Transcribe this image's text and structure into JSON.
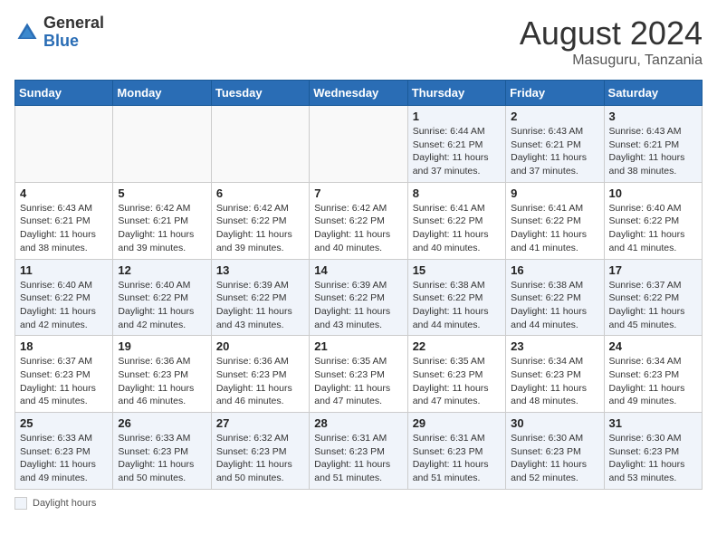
{
  "header": {
    "logo_general": "General",
    "logo_blue": "Blue",
    "title": "August 2024",
    "location": "Masuguru, Tanzania"
  },
  "weekdays": [
    "Sunday",
    "Monday",
    "Tuesday",
    "Wednesday",
    "Thursday",
    "Friday",
    "Saturday"
  ],
  "legend": {
    "label": "Daylight hours"
  },
  "weeks": [
    [
      {
        "day": "",
        "info": ""
      },
      {
        "day": "",
        "info": ""
      },
      {
        "day": "",
        "info": ""
      },
      {
        "day": "",
        "info": ""
      },
      {
        "day": "1",
        "info": "Sunrise: 6:44 AM\nSunset: 6:21 PM\nDaylight: 11 hours and 37 minutes."
      },
      {
        "day": "2",
        "info": "Sunrise: 6:43 AM\nSunset: 6:21 PM\nDaylight: 11 hours and 37 minutes."
      },
      {
        "day": "3",
        "info": "Sunrise: 6:43 AM\nSunset: 6:21 PM\nDaylight: 11 hours and 38 minutes."
      }
    ],
    [
      {
        "day": "4",
        "info": "Sunrise: 6:43 AM\nSunset: 6:21 PM\nDaylight: 11 hours and 38 minutes."
      },
      {
        "day": "5",
        "info": "Sunrise: 6:42 AM\nSunset: 6:21 PM\nDaylight: 11 hours and 39 minutes."
      },
      {
        "day": "6",
        "info": "Sunrise: 6:42 AM\nSunset: 6:22 PM\nDaylight: 11 hours and 39 minutes."
      },
      {
        "day": "7",
        "info": "Sunrise: 6:42 AM\nSunset: 6:22 PM\nDaylight: 11 hours and 40 minutes."
      },
      {
        "day": "8",
        "info": "Sunrise: 6:41 AM\nSunset: 6:22 PM\nDaylight: 11 hours and 40 minutes."
      },
      {
        "day": "9",
        "info": "Sunrise: 6:41 AM\nSunset: 6:22 PM\nDaylight: 11 hours and 41 minutes."
      },
      {
        "day": "10",
        "info": "Sunrise: 6:40 AM\nSunset: 6:22 PM\nDaylight: 11 hours and 41 minutes."
      }
    ],
    [
      {
        "day": "11",
        "info": "Sunrise: 6:40 AM\nSunset: 6:22 PM\nDaylight: 11 hours and 42 minutes."
      },
      {
        "day": "12",
        "info": "Sunrise: 6:40 AM\nSunset: 6:22 PM\nDaylight: 11 hours and 42 minutes."
      },
      {
        "day": "13",
        "info": "Sunrise: 6:39 AM\nSunset: 6:22 PM\nDaylight: 11 hours and 43 minutes."
      },
      {
        "day": "14",
        "info": "Sunrise: 6:39 AM\nSunset: 6:22 PM\nDaylight: 11 hours and 43 minutes."
      },
      {
        "day": "15",
        "info": "Sunrise: 6:38 AM\nSunset: 6:22 PM\nDaylight: 11 hours and 44 minutes."
      },
      {
        "day": "16",
        "info": "Sunrise: 6:38 AM\nSunset: 6:22 PM\nDaylight: 11 hours and 44 minutes."
      },
      {
        "day": "17",
        "info": "Sunrise: 6:37 AM\nSunset: 6:22 PM\nDaylight: 11 hours and 45 minutes."
      }
    ],
    [
      {
        "day": "18",
        "info": "Sunrise: 6:37 AM\nSunset: 6:23 PM\nDaylight: 11 hours and 45 minutes."
      },
      {
        "day": "19",
        "info": "Sunrise: 6:36 AM\nSunset: 6:23 PM\nDaylight: 11 hours and 46 minutes."
      },
      {
        "day": "20",
        "info": "Sunrise: 6:36 AM\nSunset: 6:23 PM\nDaylight: 11 hours and 46 minutes."
      },
      {
        "day": "21",
        "info": "Sunrise: 6:35 AM\nSunset: 6:23 PM\nDaylight: 11 hours and 47 minutes."
      },
      {
        "day": "22",
        "info": "Sunrise: 6:35 AM\nSunset: 6:23 PM\nDaylight: 11 hours and 47 minutes."
      },
      {
        "day": "23",
        "info": "Sunrise: 6:34 AM\nSunset: 6:23 PM\nDaylight: 11 hours and 48 minutes."
      },
      {
        "day": "24",
        "info": "Sunrise: 6:34 AM\nSunset: 6:23 PM\nDaylight: 11 hours and 49 minutes."
      }
    ],
    [
      {
        "day": "25",
        "info": "Sunrise: 6:33 AM\nSunset: 6:23 PM\nDaylight: 11 hours and 49 minutes."
      },
      {
        "day": "26",
        "info": "Sunrise: 6:33 AM\nSunset: 6:23 PM\nDaylight: 11 hours and 50 minutes."
      },
      {
        "day": "27",
        "info": "Sunrise: 6:32 AM\nSunset: 6:23 PM\nDaylight: 11 hours and 50 minutes."
      },
      {
        "day": "28",
        "info": "Sunrise: 6:31 AM\nSunset: 6:23 PM\nDaylight: 11 hours and 51 minutes."
      },
      {
        "day": "29",
        "info": "Sunrise: 6:31 AM\nSunset: 6:23 PM\nDaylight: 11 hours and 51 minutes."
      },
      {
        "day": "30",
        "info": "Sunrise: 6:30 AM\nSunset: 6:23 PM\nDaylight: 11 hours and 52 minutes."
      },
      {
        "day": "31",
        "info": "Sunrise: 6:30 AM\nSunset: 6:23 PM\nDaylight: 11 hours and 53 minutes."
      }
    ]
  ]
}
